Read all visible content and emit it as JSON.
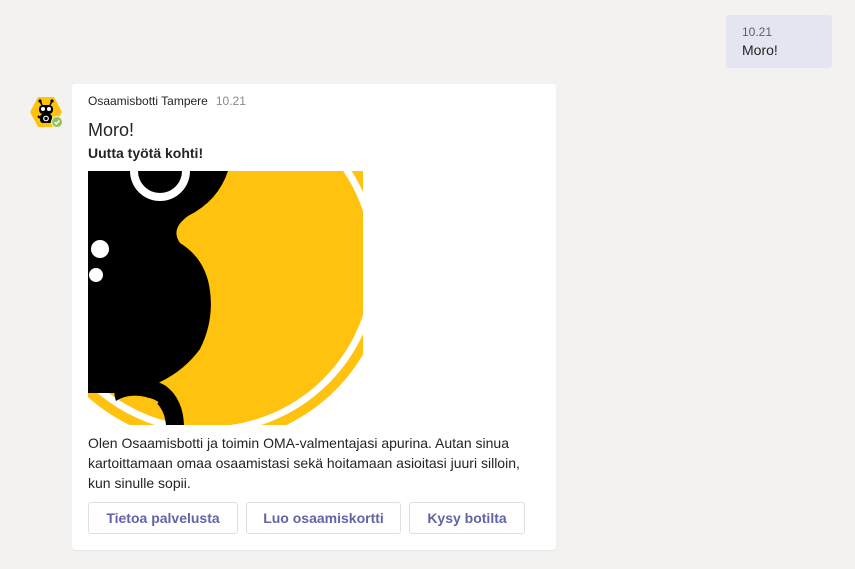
{
  "user_message": {
    "time": "10.21",
    "text": "Moro!"
  },
  "bot": {
    "sender": "Osaamisbotti Tampere",
    "time": "10.21",
    "avatar_icon": "robot-avatar-icon",
    "presence": "available",
    "presence_color": "#92c353"
  },
  "card": {
    "title": "Moro!",
    "subtitle": "Uutta työtä kohti!",
    "body": "Olen Osaamisbotti ja toimin OMA-valmentajasi apurina. Autan sinua kartoittamaan omaa osaamistasi sekä hoitamaan asioitasi juuri silloin, kun sinulle sopii.",
    "buttons": [
      {
        "label": "Tietoa palvelusta"
      },
      {
        "label": "Luo osaamiskortti"
      },
      {
        "label": "Kysy botilta"
      }
    ],
    "accent_color": "#6264a7",
    "hero_colors": {
      "yellow": "#ffc20e",
      "black": "#000000"
    }
  }
}
